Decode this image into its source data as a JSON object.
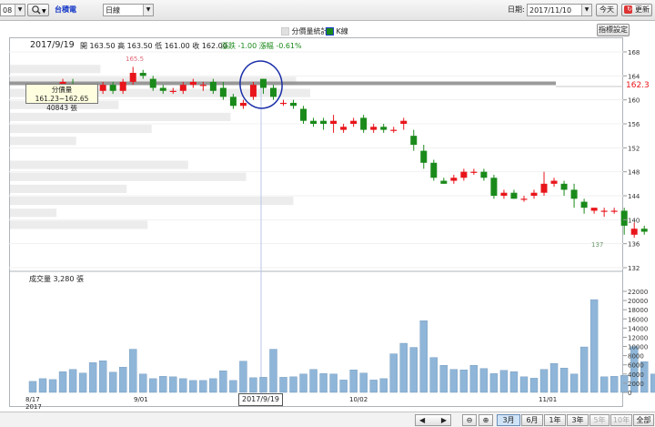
{
  "toolbar": {
    "code_value": "08",
    "stock_name": "台積電",
    "period_value": "日線",
    "date_label": "日期:",
    "date_value": "2017/11/10",
    "today_button": "今天",
    "refresh_button": "更新",
    "indicator_button": "指標設定"
  },
  "header": {
    "date": "2017/9/19",
    "open_label": "開",
    "open": "163.50",
    "high_label": "高",
    "high": "163.50",
    "low_label": "低",
    "low": "161.00",
    "close_label": "收",
    "close": "162.00",
    "change_text": "漲跌 -1.00  漲幅 -0.61%",
    "legend_profile": "分價量統計",
    "legend_k": "K線"
  },
  "tooltip": {
    "range": "分價量161.23~162.65",
    "volume": "40843 張"
  },
  "price_readout": "162.3",
  "volume_title": "成交量 3,280 張",
  "crosshair_date": "2017/9/19",
  "x_labels": [
    "8/17",
    "2017",
    "9/01",
    "10/02",
    "11/01"
  ],
  "bottom_bar": {
    "zoom_buttons": [
      "3月",
      "6月",
      "1年",
      "3年",
      "5年",
      "10年",
      "全部"
    ],
    "active": "3月"
  },
  "colors": {
    "up": "#e8151b",
    "down": "#1a8a1a",
    "volume_bar": "#8fb6d8",
    "highlight_line": "#808080",
    "annotation_circle": "#1b2fa8"
  },
  "chart_data": {
    "type": "candlestick",
    "price_axis": {
      "min": 132,
      "max": 168,
      "ticks": [
        132,
        136,
        140,
        144,
        148,
        152,
        156,
        160,
        164,
        168
      ]
    },
    "volume_axis": {
      "min": 0,
      "max": 22000,
      "ticks": [
        0,
        2000,
        4000,
        6000,
        8000,
        10000,
        12000,
        14000,
        16000,
        18000,
        20000,
        22000
      ]
    },
    "annotations": {
      "max_price": "165.5",
      "min_price": "137"
    },
    "candles": [
      [
        160,
        161,
        159.5,
        160.5
      ],
      [
        160.5,
        161.5,
        160,
        161
      ],
      [
        161,
        162.5,
        160.5,
        162
      ],
      [
        162,
        163.5,
        161.5,
        163
      ],
      [
        162.5,
        163.5,
        161,
        162
      ],
      [
        162,
        162.5,
        160.5,
        161
      ],
      [
        161,
        162,
        160,
        161.5
      ],
      [
        161.5,
        163,
        161,
        162.5
      ],
      [
        162.5,
        163,
        161,
        161.5
      ],
      [
        161.5,
        163.5,
        161,
        163
      ],
      [
        163,
        165.5,
        162.5,
        164.5
      ],
      [
        164.5,
        165,
        163.5,
        164
      ],
      [
        163.5,
        164,
        161.5,
        162
      ],
      [
        162,
        162.5,
        161,
        161.5
      ],
      [
        161.5,
        162,
        161,
        161.5
      ],
      [
        161.5,
        163,
        161,
        162.5
      ],
      [
        162.5,
        163.5,
        162,
        163
      ],
      [
        162.5,
        163,
        161.5,
        162.5
      ],
      [
        163,
        163.5,
        161,
        161.5
      ],
      [
        162,
        163,
        160,
        160.5
      ],
      [
        160.5,
        161,
        158.5,
        159
      ],
      [
        159,
        160,
        158.5,
        159.5
      ],
      [
        160.5,
        163,
        160,
        162.5
      ],
      [
        163.5,
        163.5,
        161,
        162
      ],
      [
        162,
        162.5,
        160,
        160.5
      ],
      [
        159.5,
        160,
        159,
        159.5
      ],
      [
        159.5,
        160,
        158.5,
        159
      ],
      [
        158.5,
        159,
        156,
        156.5
      ],
      [
        156.5,
        157,
        155.5,
        156
      ],
      [
        156.5,
        157,
        155,
        156
      ],
      [
        156,
        157.5,
        154.5,
        156.5
      ],
      [
        155,
        156,
        154.5,
        155.5
      ],
      [
        156,
        157,
        155.5,
        156.5
      ],
      [
        157,
        157.5,
        154.5,
        155
      ],
      [
        155,
        156,
        154.5,
        155.5
      ],
      [
        155.5,
        156,
        154.5,
        155
      ],
      [
        155,
        155.5,
        154.5,
        155
      ],
      [
        156,
        157,
        155,
        156.5
      ],
      [
        154,
        155,
        151.5,
        152.5
      ],
      [
        151.5,
        152.5,
        148.5,
        149.5
      ],
      [
        149.5,
        150,
        146.5,
        147
      ],
      [
        146.5,
        147,
        146,
        146
      ],
      [
        146.5,
        147.5,
        146,
        147
      ],
      [
        147,
        148.5,
        146.5,
        148
      ],
      [
        148,
        148.5,
        147.5,
        148
      ],
      [
        148,
        148.5,
        146.5,
        147
      ],
      [
        147,
        147.5,
        143.5,
        144
      ],
      [
        144,
        145,
        143.5,
        144.5
      ],
      [
        144.5,
        145,
        143.5,
        143.5
      ],
      [
        143.5,
        144,
        143,
        143.5
      ],
      [
        144,
        145,
        143.5,
        144.5
      ],
      [
        144.5,
        148,
        144,
        146
      ],
      [
        146,
        147,
        145.5,
        146.5
      ],
      [
        146,
        146.5,
        144,
        145
      ],
      [
        145,
        146,
        142,
        143.5
      ],
      [
        143,
        143.5,
        141,
        142
      ],
      [
        141.5,
        142,
        141,
        142
      ],
      [
        141.5,
        142,
        140.5,
        141.5
      ],
      [
        141.5,
        142,
        141,
        141.5
      ],
      [
        141.5,
        142,
        137.5,
        139
      ],
      [
        137.5,
        139.5,
        137,
        138.5
      ],
      [
        138.5,
        139,
        137.5,
        138
      ]
    ],
    "volumes": [
      2400,
      3000,
      2800,
      4500,
      5000,
      4200,
      6500,
      6900,
      4400,
      5500,
      9400,
      4000,
      3000,
      3500,
      3400,
      3000,
      2600,
      2600,
      3000,
      4700,
      2600,
      6800,
      3200,
      3300,
      9400,
      3300,
      3400,
      4000,
      5000,
      4100,
      4000,
      2700,
      4900,
      4200,
      2700,
      3000,
      8400,
      10700,
      9800,
      15600,
      7600,
      5900,
      5000,
      4900,
      5900,
      5200,
      4100,
      4800,
      4500,
      3400,
      3100,
      5000,
      6300,
      5300,
      4000,
      9900,
      20200,
      3400,
      3500,
      3700,
      10000,
      6700,
      4000,
      2800
    ]
  }
}
